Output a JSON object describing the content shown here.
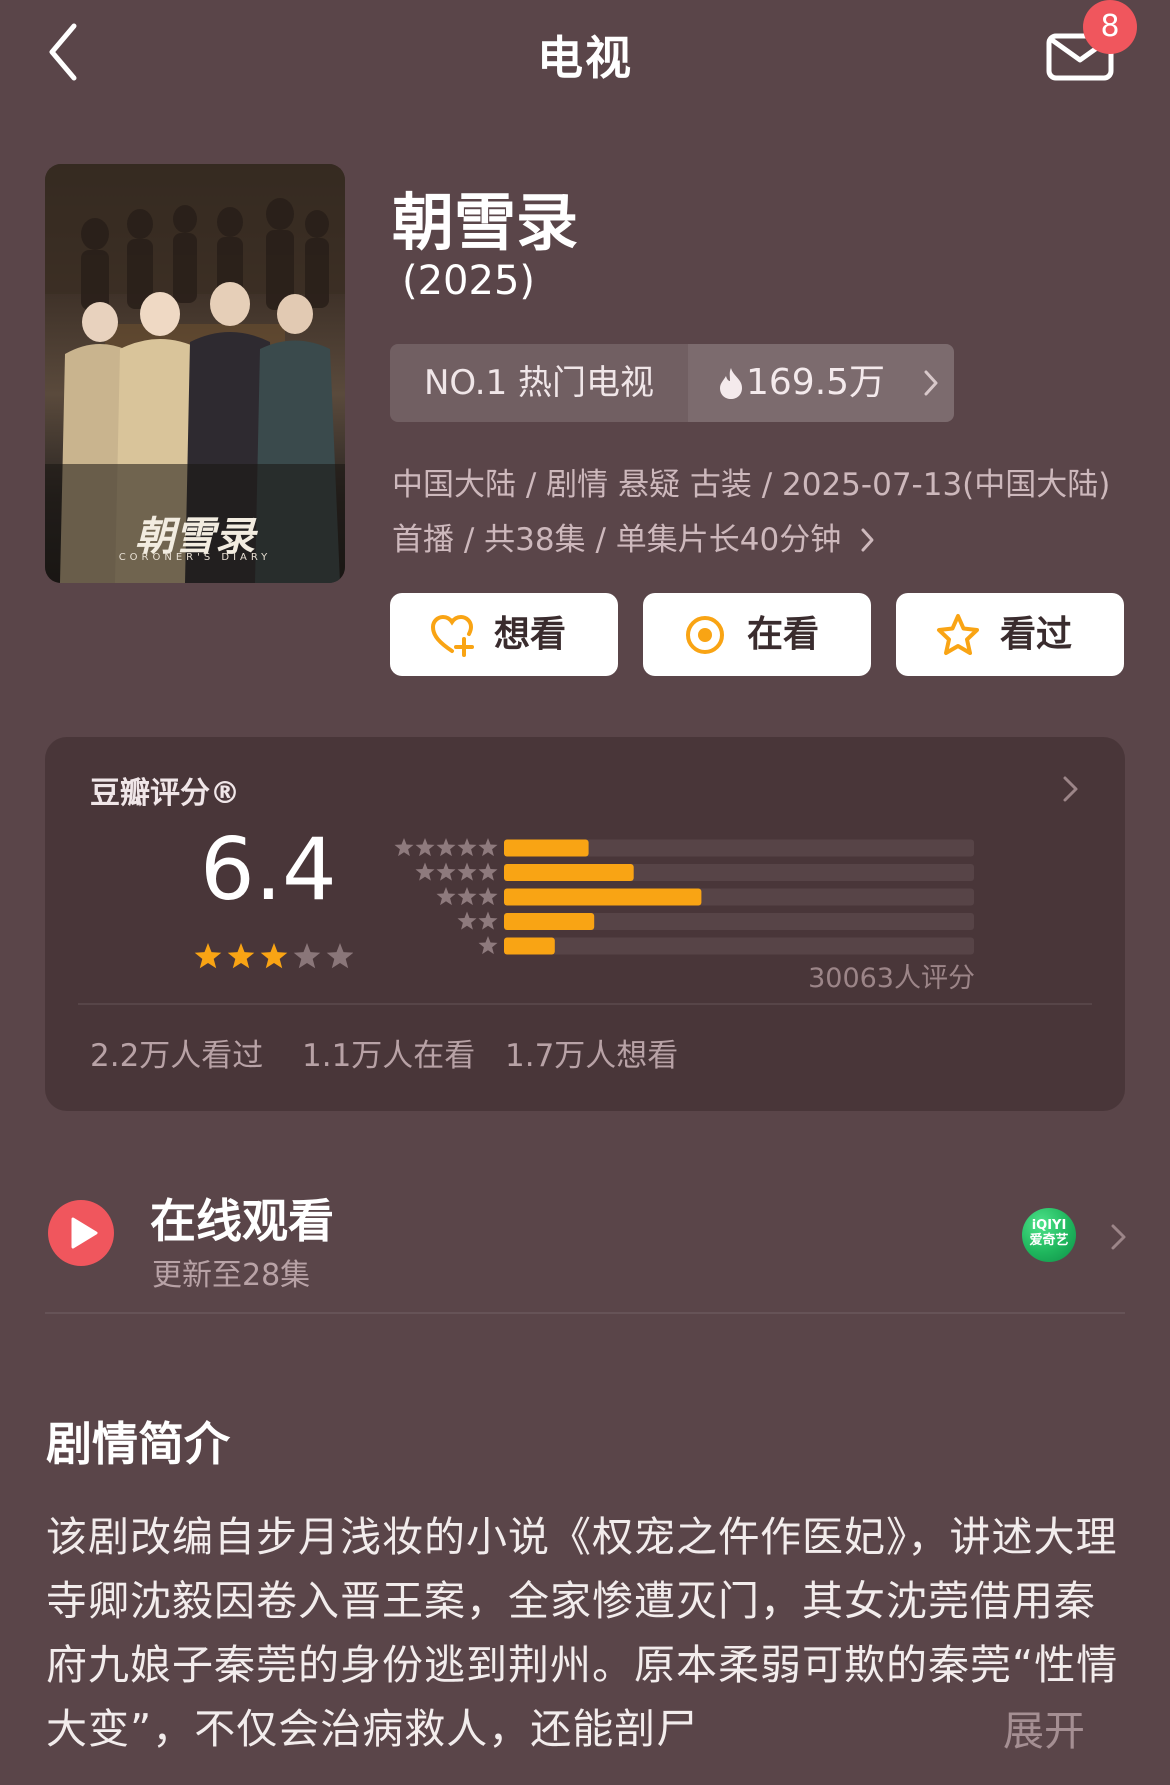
{
  "header": {
    "title": "电视",
    "message_badge": "8"
  },
  "show": {
    "name": "朝雪录",
    "year": "(2025)",
    "poster_title": "朝雪录",
    "poster_subtitle": "CORONER'S DIARY",
    "hot_rank": "NO.1 热门电视",
    "hot_count": "169.5万",
    "meta": "中国大陆 / 剧情 悬疑 古装 / 2025-07-13(中国大陆) 首播 / 共38集 / 单集片长40分钟"
  },
  "actions": {
    "want": "想看",
    "watching": "在看",
    "watched": "看过"
  },
  "rating": {
    "label": "豆瓣评分®",
    "score": "6.4",
    "stars": 3,
    "count_text": "30063人评分",
    "distribution_percent": [
      15,
      23,
      35,
      16,
      9
    ],
    "stats": [
      "2.2万人看过",
      "1.1万人在看",
      "1.7万人想看"
    ]
  },
  "online": {
    "title": "在线观看",
    "subtitle": "更新至28集",
    "provider_top": "iQIYI",
    "provider_bottom": "爱奇艺"
  },
  "synopsis": {
    "title": "剧情简介",
    "text": "该剧改编自步月浅妆的小说《权宠之仵作医妃》，讲述大理寺卿沈毅因卷入晋王案，全家惨遭灭门，其女沈莞借用秦府九娘子秦莞的身份逃到荆州。原本柔弱可欺的秦莞“性情大变”，不仅会治病救人，还能剖尸",
    "expand": "展开"
  },
  "colors": {
    "accent_orange": "#f9a414",
    "background": "#5a4549",
    "card": "#493639",
    "badge_red": "#f0565d",
    "play_red": "#f0565d"
  }
}
